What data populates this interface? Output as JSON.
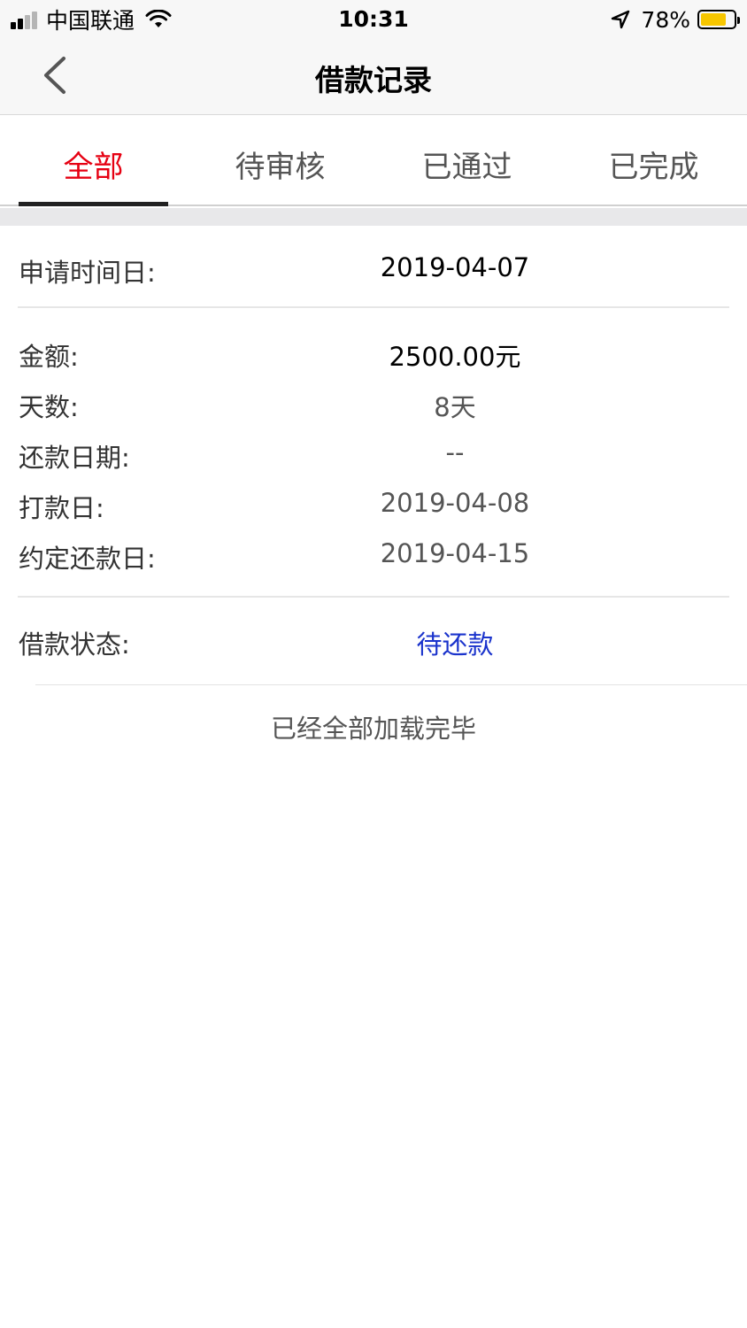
{
  "status_bar": {
    "carrier": "中国联通",
    "time": "10:31",
    "battery_percent": "78%",
    "battery_level": 0.78,
    "signal_bars": 4,
    "signal_active": 2,
    "battery_color": "#f7c600"
  },
  "nav": {
    "title": "借款记录",
    "back_icon": "chevron-left-icon"
  },
  "tabs": [
    {
      "label": "全部",
      "active": true
    },
    {
      "label": "待审核",
      "active": false
    },
    {
      "label": "已通过",
      "active": false
    },
    {
      "label": "已完成",
      "active": false
    }
  ],
  "colors": {
    "active_tab": "#e60012",
    "status_value": "#1a33cc"
  },
  "record": {
    "apply_date_label": "申请时间日:",
    "apply_date_value": "2019-04-07",
    "amount_label": "金额:",
    "amount_value": "2500.00元",
    "days_label": "天数:",
    "days_value": "8天",
    "repay_date_label": "还款日期:",
    "repay_date_value": "--",
    "pay_date_label": "打款日:",
    "pay_date_value": "2019-04-08",
    "agreed_repay_label": "约定还款日:",
    "agreed_repay_value": "2019-04-15",
    "status_label": "借款状态:",
    "status_value": "待还款"
  },
  "footer": {
    "text": "已经全部加载完毕"
  }
}
